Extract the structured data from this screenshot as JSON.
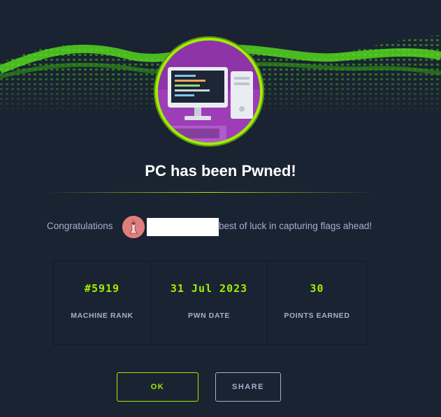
{
  "modal": {
    "title": "PC has been Pwned!",
    "congrats_prefix": "Congratulations",
    "congrats_suffix": "best of luck in capturing flags ahead!"
  },
  "stats": [
    {
      "value": "#5919",
      "label": "MACHINE RANK"
    },
    {
      "value": "31 Jul 2023",
      "label": "PWN DATE"
    },
    {
      "value": "30",
      "label": "POINTS EARNED"
    }
  ],
  "buttons": {
    "ok": "OK",
    "share": "SHARE"
  },
  "colors": {
    "accent": "#9fef00",
    "background": "#1a2332",
    "text_muted": "#a4b1cd"
  }
}
